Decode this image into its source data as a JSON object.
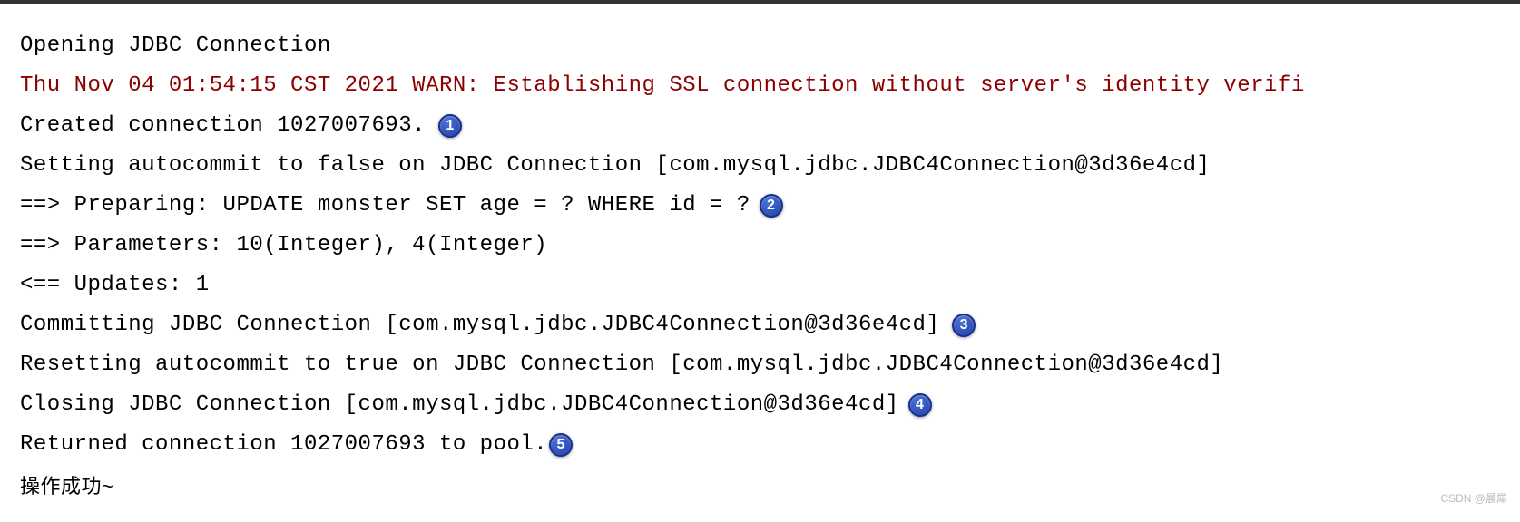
{
  "console": {
    "lines": {
      "l1": "Opening JDBC Connection",
      "l2": "Thu Nov 04 01:54:15 CST 2021 WARN: Establishing SSL connection without server's identity verifi",
      "l3": "Created connection 1027007693.",
      "l4": "Setting autocommit to false on JDBC Connection [com.mysql.jdbc.JDBC4Connection@3d36e4cd]",
      "l5": "==>  Preparing: UPDATE monster SET age = ? WHERE id = ?",
      "l6": "==> Parameters: 10(Integer), 4(Integer)",
      "l7": "<==    Updates: 1",
      "l8": "Committing JDBC Connection [com.mysql.jdbc.JDBC4Connection@3d36e4cd]",
      "l9": "Resetting autocommit to true on JDBC Connection [com.mysql.jdbc.JDBC4Connection@3d36e4cd]",
      "l10": "Closing JDBC Connection [com.mysql.jdbc.JDBC4Connection@3d36e4cd]",
      "l11": "Returned connection 1027007693 to pool.",
      "l12": "操作成功~"
    }
  },
  "badges": {
    "b1": "1",
    "b2": "2",
    "b3": "3",
    "b4": "4",
    "b5": "5"
  },
  "watermark": "CSDN @晨犀"
}
